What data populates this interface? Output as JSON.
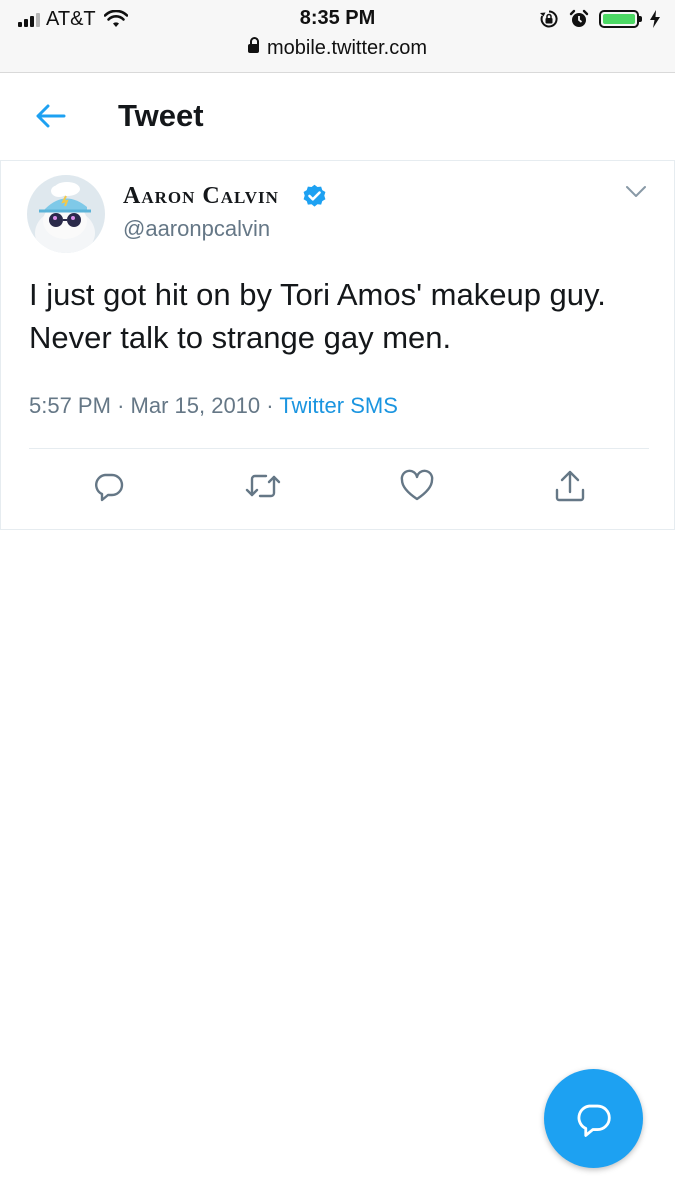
{
  "status_bar": {
    "carrier": "AT&T",
    "time": "8:35 PM",
    "url": "mobile.twitter.com",
    "battery_level": 1.0,
    "battery_color": "#4cd964"
  },
  "header": {
    "back_icon": "arrow-left-icon",
    "title": "Tweet"
  },
  "tweet": {
    "author_name": "Aaron Calvin",
    "verified": true,
    "handle": "@aaronpcalvin",
    "text": "I just got hit on by Tori Amos' makeup guy. Never talk to strange gay men.",
    "time": "5:57 PM",
    "date": "Mar 15, 2010",
    "source": "Twitter SMS",
    "separator": "·"
  },
  "actions": [
    "reply-icon",
    "retweet-icon",
    "like-icon",
    "share-icon"
  ],
  "fab": {
    "icon": "compose-reply-icon"
  },
  "colors": {
    "accent": "#1da1f2",
    "link": "#1b95e0",
    "muted": "#657786",
    "text": "#14171a"
  }
}
